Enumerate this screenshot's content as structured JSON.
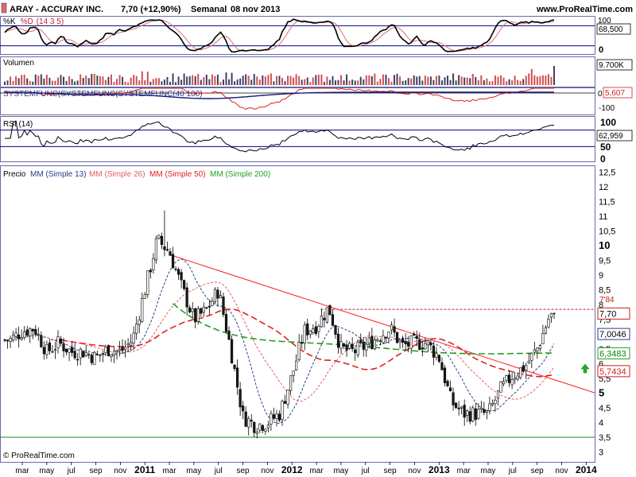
{
  "header": {
    "ticker": "ARAY - ACCURAY INC.",
    "last": "7,70 (+12,90%)",
    "period": "Semanal",
    "date": "08 nov 2013",
    "site": "www.ProRealTime.com"
  },
  "footer": {
    "copyright": "© ProRealTime.com"
  },
  "colors": {
    "panel_border": "#6a6aa8",
    "sma13": "#283c8c",
    "sma26": "#e06060",
    "sma50": "#e02020",
    "sma200": "#20a020",
    "candle_up": "#ffffff",
    "candle_down": "#1a1a1a",
    "volume_up": "#d05050",
    "volume_down": "#404060",
    "trendline": "#ff2020",
    "band_line": "#000088"
  },
  "icons": {
    "up_arrow": "green-up-arrow-icon"
  },
  "x_axis": {
    "labels": [
      "mar",
      "may",
      "jul",
      "sep",
      "nov",
      "2011",
      "mar",
      "may",
      "jul",
      "sep",
      "nov",
      "2012",
      "mar",
      "may",
      "jul",
      "sep",
      "nov",
      "2013",
      "mar",
      "may",
      "jul",
      "sep",
      "nov",
      "2014"
    ],
    "bold": [
      false,
      false,
      false,
      false,
      false,
      true,
      false,
      false,
      false,
      false,
      false,
      true,
      false,
      false,
      false,
      false,
      false,
      true,
      false,
      false,
      false,
      false,
      false,
      true
    ]
  },
  "panels": {
    "stoch": {
      "label_pre": "%K",
      "label_mid": "%D",
      "label_params": "(14 3 5)",
      "scale": [
        "100",
        "68,500",
        "0"
      ],
      "current": "68,500"
    },
    "volume": {
      "label": "Volumen",
      "current": "9.700K"
    },
    "system": {
      "label": "SYSTEMFUNC(SYSTEMFUNC(SYSTEMFUNC(40 100)",
      "scale": [
        "0",
        "-100"
      ],
      "current": "5,607"
    },
    "rsi": {
      "label": "RSI (14)",
      "scale": [
        "100",
        "50",
        "0"
      ],
      "current": "62,959"
    },
    "price": {
      "label": "Precio",
      "legend": [
        {
          "text": "MM (Simple 13)",
          "color": "#283c8c"
        },
        {
          "text": "MM (Simple 26)",
          "color": "#e06060"
        },
        {
          "text": "MM (Simple 50)",
          "color": "#e02020"
        },
        {
          "text": "MM (Simple 200)",
          "color": "#20a020"
        }
      ],
      "tags": {
        "resistance": "7'84",
        "last": "7,70",
        "sma13": "7,0046",
        "sma200": "6,3483",
        "sma50": "5,7434"
      }
    }
  },
  "chart_data": {
    "type": "candlestick",
    "title": "ARAY - ACCURAY INC.",
    "period": "Semanal",
    "last_value": 7.7,
    "y_ticks": [
      12.5,
      12,
      11.5,
      11,
      10.5,
      10,
      9.5,
      9,
      8.5,
      8,
      7.5,
      7,
      6.5,
      6,
      5.5,
      5,
      4.5,
      4,
      3.5,
      3
    ],
    "y_tick_labels": [
      "12,5",
      "12",
      "11,5",
      "11",
      "10,5",
      "10",
      "9,5",
      "9",
      "8,5",
      "8",
      "7,5",
      "7",
      "6,5",
      "6",
      "5,5",
      "5",
      "4,5",
      "4",
      "3,5",
      "3"
    ],
    "ylim": [
      3,
      12.5
    ],
    "resistance_level": 7.84,
    "support_level": 3.5,
    "trendline": [
      {
        "x": "2011-03",
        "y": 9.7
      },
      {
        "x": "2014-01",
        "y": 5.1
      }
    ],
    "price_path": [
      [
        "2010-02",
        6.8
      ],
      [
        "2010-03",
        7.1
      ],
      [
        "2010-04",
        7.2
      ],
      [
        "2010-05",
        6.4
      ],
      [
        "2010-06",
        6.7
      ],
      [
        "2010-07",
        6.4
      ],
      [
        "2010-08",
        6.4
      ],
      [
        "2010-09",
        6.2
      ],
      [
        "2010-10",
        6.5
      ],
      [
        "2010-11",
        6.4
      ],
      [
        "2010-12",
        6.8
      ],
      [
        "2011-01",
        8.5
      ],
      [
        "2011-02",
        10.2
      ],
      [
        "2011-03",
        9.8
      ],
      [
        "2011-04",
        8.6
      ],
      [
        "2011-05",
        7.5
      ],
      [
        "2011-06",
        7.8
      ],
      [
        "2011-07",
        8.5
      ],
      [
        "2011-08",
        6.5
      ],
      [
        "2011-09",
        4.2
      ],
      [
        "2011-10",
        3.9
      ],
      [
        "2011-11",
        4.0
      ],
      [
        "2011-12",
        4.3
      ],
      [
        "2012-01",
        5.6
      ],
      [
        "2012-02",
        7.1
      ],
      [
        "2012-03",
        7.3
      ],
      [
        "2012-04",
        7.9
      ],
      [
        "2012-05",
        6.5
      ],
      [
        "2012-06",
        6.4
      ],
      [
        "2012-07",
        6.6
      ],
      [
        "2012-08",
        6.9
      ],
      [
        "2012-09",
        7.2
      ],
      [
        "2012-10",
        6.6
      ],
      [
        "2012-11",
        6.7
      ],
      [
        "2012-12",
        6.7
      ],
      [
        "2013-01",
        6.2
      ],
      [
        "2013-02",
        4.7
      ],
      [
        "2013-03",
        4.3
      ],
      [
        "2013-04",
        4.3
      ],
      [
        "2013-05",
        4.3
      ],
      [
        "2013-06",
        5.1
      ],
      [
        "2013-07",
        5.6
      ],
      [
        "2013-08",
        5.9
      ],
      [
        "2013-09",
        6.5
      ],
      [
        "2013-10",
        7.6
      ],
      [
        "2013-11",
        7.7
      ]
    ],
    "series": [
      {
        "name": "MM (Simple 13)",
        "last": 7.0046
      },
      {
        "name": "MM (Simple 26)"
      },
      {
        "name": "MM (Simple 50)",
        "last": 5.7434
      },
      {
        "name": "MM (Simple 200)",
        "last": 6.3483
      }
    ],
    "stochastic": {
      "params": [
        14,
        3,
        5
      ],
      "last": 68.5,
      "levels": [
        80,
        20
      ]
    },
    "rsi": {
      "period": 14,
      "last": 62.959,
      "levels": [
        70,
        30
      ]
    },
    "volume": {
      "last": "9.700K"
    },
    "system": {
      "last": 5.607
    }
  }
}
